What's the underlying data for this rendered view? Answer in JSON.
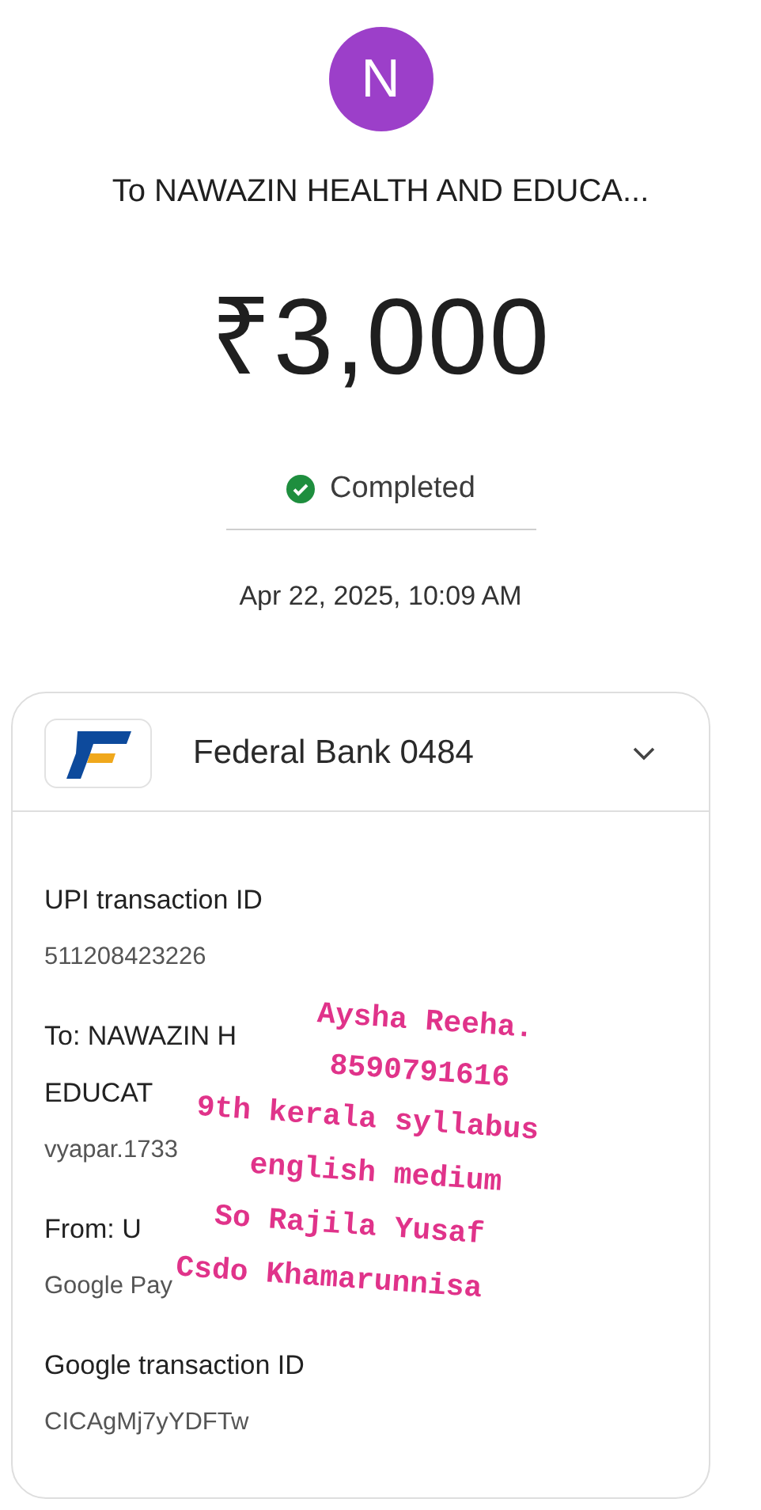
{
  "avatar": {
    "initial": "N",
    "color": "#9c3fc9"
  },
  "payee": "To NAWAZIN HEALTH AND EDUCA...",
  "amount": "₹3,000",
  "status": {
    "label": "Completed",
    "kind": "success"
  },
  "datetime": "Apr 22, 2025, 10:09 AM",
  "account": {
    "name": "Federal Bank 0484",
    "expanded": false
  },
  "details": [
    {
      "label": "UPI transaction ID",
      "value": "511208423226"
    },
    {
      "label": "To: NAWAZIN H",
      "label_line_2": "EDUCAT",
      "value": "vyapar.1733"
    },
    {
      "label": "From: U",
      "value": "Google Pay"
    },
    {
      "label": "Google transaction ID",
      "value": "CICAgMj7yYDFTw"
    }
  ],
  "note": {
    "lines": [
      "Aysha Reeha.",
      "8590791616",
      "9th kerala syllabus",
      "english medium",
      "So Rajila Yusaf",
      "Csdo Khamarunnisa"
    ]
  }
}
